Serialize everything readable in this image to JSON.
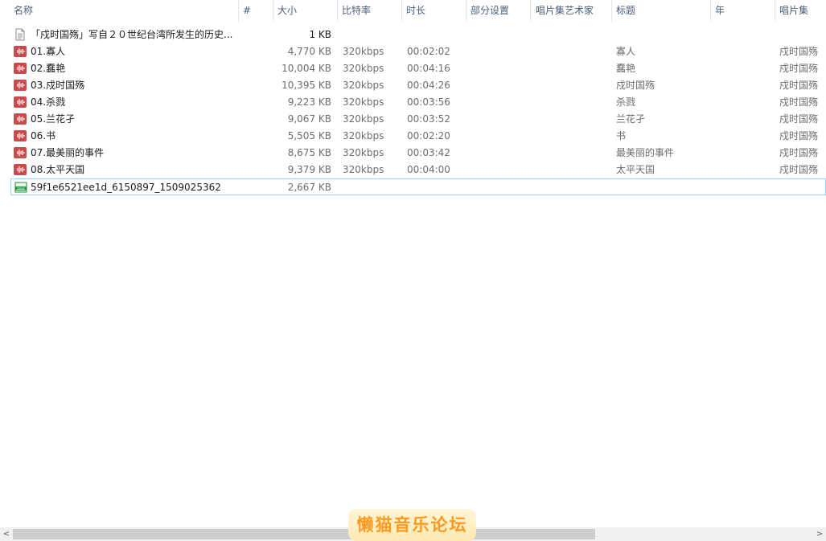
{
  "columns": {
    "name": "名称",
    "number": "#",
    "size": "大小",
    "bitrate": "比特率",
    "duration": "时长",
    "part": "部分设置",
    "album_artist": "唱片集艺术家",
    "title": "标题",
    "year": "年",
    "album": "唱片集"
  },
  "files": [
    {
      "icon": "text-file-icon",
      "name": "「戍时国殇」写自２０世纪台湾所发生的历史...",
      "size": "1 KB",
      "bitrate": "",
      "duration": "",
      "title": "",
      "album": ""
    },
    {
      "icon": "audio-file-icon",
      "name": "01.寡人",
      "size": "4,770 KB",
      "bitrate": "320kbps",
      "duration": "00:02:02",
      "title": "寡人",
      "album": "戍时国殇"
    },
    {
      "icon": "audio-file-icon",
      "name": "02.蠢艳",
      "size": "10,004 KB",
      "bitrate": "320kbps",
      "duration": "00:04:16",
      "title": "蠢艳",
      "album": "戍时国殇"
    },
    {
      "icon": "audio-file-icon",
      "name": "03.戍时国殇",
      "size": "10,395 KB",
      "bitrate": "320kbps",
      "duration": "00:04:26",
      "title": "戍时国殇",
      "album": "戍时国殇"
    },
    {
      "icon": "audio-file-icon",
      "name": "04.杀戮",
      "size": "9,223 KB",
      "bitrate": "320kbps",
      "duration": "00:03:56",
      "title": "杀戮",
      "album": "戍时国殇"
    },
    {
      "icon": "audio-file-icon",
      "name": "05.兰花孑",
      "size": "9,067 KB",
      "bitrate": "320kbps",
      "duration": "00:03:52",
      "title": "兰花孑",
      "album": "戍时国殇"
    },
    {
      "icon": "audio-file-icon",
      "name": "06.书",
      "size": "5,505 KB",
      "bitrate": "320kbps",
      "duration": "00:02:20",
      "title": "书",
      "album": "戍时国殇"
    },
    {
      "icon": "audio-file-icon",
      "name": "07.最美丽的事件",
      "size": "8,675 KB",
      "bitrate": "320kbps",
      "duration": "00:03:42",
      "title": "最美丽的事件",
      "album": "戍时国殇"
    },
    {
      "icon": "audio-file-icon",
      "name": "08.太平天国",
      "size": "9,379 KB",
      "bitrate": "320kbps",
      "duration": "00:04:00",
      "title": "太平天国",
      "album": "戍时国殇"
    },
    {
      "icon": "jpeg-file-icon",
      "name": "59f1e6521ee1d_6150897_1509025362",
      "size": "2,667 KB",
      "bitrate": "",
      "duration": "",
      "title": "",
      "album": ""
    }
  ],
  "scrollbar": {
    "left_arrow": "<",
    "right_arrow": ">"
  },
  "watermark": "懒猫音乐论坛",
  "colors": {
    "header_text": "#4c607a",
    "audio_icon": "#c94b4b",
    "jpeg_icon": "#2e8b3a",
    "focus_border": "#99d1ff",
    "watermark_text": "#ff9a1f"
  }
}
